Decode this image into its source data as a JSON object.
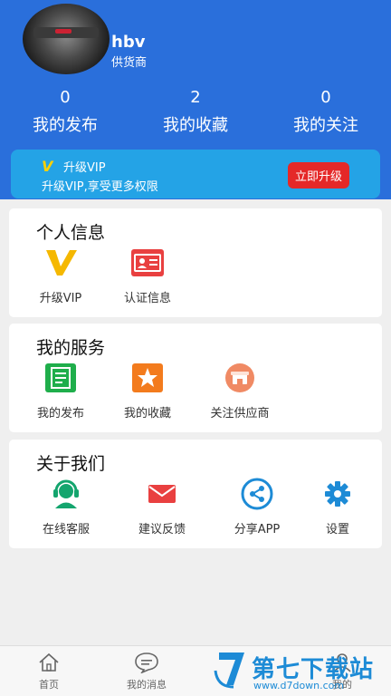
{
  "profile": {
    "name": "hbv",
    "role": "供货商"
  },
  "stats": [
    {
      "value": "0",
      "label": "我的发布"
    },
    {
      "value": "2",
      "label": "我的收藏"
    },
    {
      "value": "0",
      "label": "我的关注"
    }
  ],
  "vip": {
    "logo": "V",
    "title": "升级VIP",
    "desc": "升级VIP,享受更多权限",
    "button": "立即升级"
  },
  "personal": {
    "title": "个人信息",
    "items": [
      {
        "label": "升级VIP",
        "icon": "vip-icon"
      },
      {
        "label": "认证信息",
        "icon": "id-card-icon"
      }
    ]
  },
  "services": {
    "title": "我的服务",
    "items": [
      {
        "label": "我的发布",
        "icon": "notebook-icon"
      },
      {
        "label": "我的收藏",
        "icon": "star-icon"
      },
      {
        "label": "关注供应商",
        "icon": "store-icon"
      }
    ]
  },
  "about": {
    "title": "关于我们",
    "items": [
      {
        "label": "在线客服",
        "icon": "headset-icon"
      },
      {
        "label": "建议反馈",
        "icon": "mail-icon"
      },
      {
        "label": "分享APP",
        "icon": "share-icon"
      },
      {
        "label": "设置",
        "icon": "gear-icon"
      }
    ]
  },
  "nav": [
    {
      "label": "首页",
      "icon": "home-icon"
    },
    {
      "label": "我的消息",
      "icon": "message-icon"
    },
    {
      "label": "我的",
      "icon": "user-icon"
    }
  ],
  "watermark": {
    "title": "第七下载站",
    "url": "www.d7down.com"
  },
  "colors": {
    "header": "#2a6fdb",
    "vip_bar": "#24a3e6",
    "upgrade_button": "#e52828"
  }
}
